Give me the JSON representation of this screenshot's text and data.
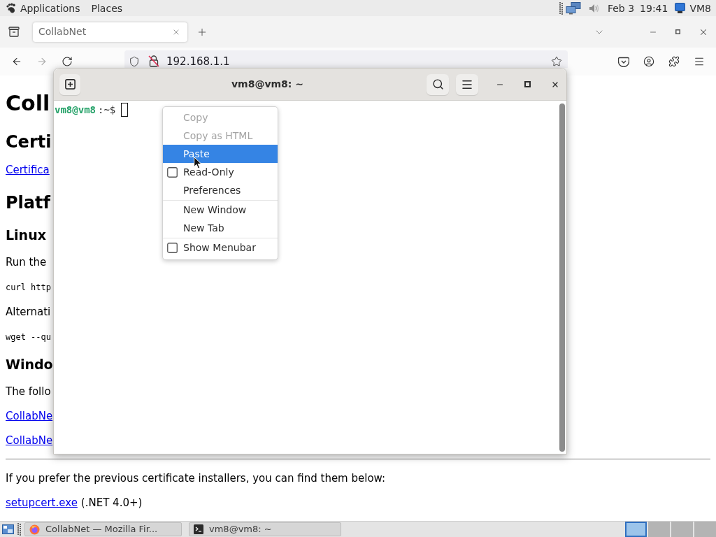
{
  "top_panel": {
    "menus": [
      "Applications",
      "Places"
    ],
    "date": "Feb 3",
    "time": "19:41",
    "user": "VM8"
  },
  "browser": {
    "tabs": [
      {
        "label": "CollabNet",
        "selected": true
      }
    ],
    "address": "192.168.1.1",
    "page": {
      "blocks": [
        {
          "kind": "h1",
          "text": "Coll"
        },
        {
          "kind": "h2",
          "text": "Certi"
        },
        {
          "kind": "link",
          "text": "Certifica"
        },
        {
          "kind": "h2",
          "text": "Platf"
        },
        {
          "kind": "h3",
          "text": "Linux"
        },
        {
          "kind": "p",
          "text": "Run the"
        },
        {
          "kind": "code",
          "text": "curl http"
        },
        {
          "kind": "p",
          "text": "Alternati"
        },
        {
          "kind": "code",
          "text": "wget --qu"
        },
        {
          "kind": "h3",
          "text": "Windo"
        },
        {
          "kind": "p",
          "text": "The follo"
        },
        {
          "kind": "link",
          "text": "CollabNe"
        },
        {
          "kind": "link",
          "text": "CollabNe"
        },
        {
          "kind": "rule"
        },
        {
          "kind": "p",
          "text": "If you prefer the previous certificate installers, you can find them below:"
        },
        {
          "kind": "link_note",
          "link": "setupcert.exe",
          "text": "(.NET 4.0+)"
        }
      ]
    }
  },
  "terminal": {
    "title": "vm8@vm8: ~",
    "prompt_user": "vm8@vm8",
    "prompt_path": ":~$"
  },
  "context_menu": {
    "groups": [
      {
        "items": [
          {
            "kind": "action",
            "label": "Copy",
            "disabled": true,
            "selected": false
          },
          {
            "kind": "action",
            "label": "Copy as HTML",
            "disabled": true,
            "selected": false
          },
          {
            "kind": "action",
            "label": "Paste",
            "disabled": false,
            "selected": true
          },
          {
            "kind": "toggle",
            "label": "Read-Only",
            "disabled": false,
            "selected": false,
            "checked": false
          },
          {
            "kind": "action",
            "label": "Preferences",
            "disabled": false,
            "selected": false
          }
        ]
      },
      {
        "items": [
          {
            "kind": "action",
            "label": "New Window",
            "disabled": false,
            "selected": false
          },
          {
            "kind": "action",
            "label": "New Tab",
            "disabled": false,
            "selected": false
          }
        ]
      },
      {
        "items": [
          {
            "kind": "toggle",
            "label": "Show Menubar",
            "disabled": false,
            "selected": false,
            "checked": false
          }
        ]
      }
    ]
  },
  "taskbar": {
    "windows": [
      {
        "kind": "browser",
        "label": "CollabNet — Mozilla Fir..."
      },
      {
        "kind": "terminal",
        "label": "vm8@vm8: ~"
      }
    ],
    "workspaces": [
      {
        "selected": true
      },
      {
        "selected": false
      },
      {
        "selected": false
      },
      {
        "selected": false
      }
    ]
  }
}
